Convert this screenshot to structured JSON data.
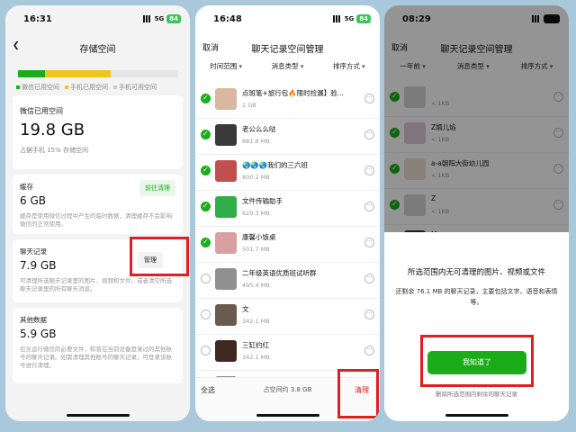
{
  "phone1": {
    "status": {
      "time": "16:31",
      "network": "5G",
      "battery": "84"
    },
    "title": "存储空间",
    "usage": {
      "wechat_pct": 17,
      "phone_pct": 41,
      "colors": {
        "wechat": "#1aad19",
        "phone": "#f0c419",
        "free": "#e6e6e6"
      },
      "legend": [
        "微信已用空间",
        "手机已用空间",
        "手机可用空间"
      ]
    },
    "summary": {
      "label": "微信已用空间",
      "value": "19.8 GB",
      "sub": "占据手机 15% 存储空间"
    },
    "cache": {
      "label": "缓存",
      "value": "6 GB",
      "desc": "缓存是使用微信过程中产生的临时数据，清理缓存不会影响微信的正常使用。",
      "button": "前往清理"
    },
    "chat": {
      "label": "聊天记录",
      "value": "7.9 GB",
      "desc": "可清理所选聊天记录里的图片、视频和文件，或者清空所选聊天记录里的所有聊天消息。",
      "button": "管理"
    },
    "other": {
      "label": "其他数据",
      "value": "5.9 GB",
      "desc": "包含运行微信的必要文件，和曾在当前设备登录过的其他账号的聊天记录。如需清理其他账号的聊天记录，可登录该账号进行清理。"
    }
  },
  "phone2": {
    "status": {
      "time": "16:48",
      "network": "5G",
      "battery": "84"
    },
    "cancel": "取消",
    "title": "聊天记录空间管理",
    "filters": [
      "时间范围",
      "消息类型",
      "排序方式"
    ],
    "chats": [
      {
        "name": "点斑笔+旅行包🔥限时捡漏】验...",
        "size": "1 GB",
        "checked": true,
        "avatar": "#d8b8a0"
      },
      {
        "name": "老公么么哒",
        "size": "881.8 MB",
        "checked": true,
        "avatar": "#3a3a3a"
      },
      {
        "name": "🌏🌏🌏我们的三六班",
        "size": "800.2 MB",
        "checked": true,
        "avatar": "#c05050"
      },
      {
        "name": "文件传输助手",
        "size": "629.3 MB",
        "checked": true,
        "avatar": "#2fae4a"
      },
      {
        "name": "康馨小饭桌",
        "size": "501.7 MB",
        "checked": true,
        "avatar": "#d8a0a0"
      },
      {
        "name": "二年级英语优质班试听群",
        "size": "495.4 MB",
        "checked": false,
        "avatar": "#909090"
      },
      {
        "name": "文",
        "size": "342.1 MB",
        "checked": false,
        "avatar": "#6a5a50"
      },
      {
        "name": "三缸约红",
        "size": "342.1 MB",
        "checked": false,
        "avatar": "#402820"
      },
      {
        "name": "三（6）班家长交流群",
        "size": "",
        "checked": false,
        "avatar": "#8a8a8a"
      }
    ],
    "bottom": {
      "select_all": "全选",
      "occupy": "占空间约 3.8 GB",
      "clean": "清理"
    }
  },
  "phone3": {
    "status": {
      "time": "08:29"
    },
    "cancel": "取消",
    "title": "聊天记录空间管理",
    "filters": [
      "一年前",
      "消息类型",
      "排序方式"
    ],
    "chats": [
      {
        "name": "",
        "size": "< 1KB",
        "avatar": "#d5d5d5"
      },
      {
        "name": "Z婿儿焰",
        "size": "< 1KB",
        "avatar": "#e0c8d8"
      },
      {
        "name": "a-a朝阳大街幼儿园",
        "size": "< 1KB",
        "avatar": "#e8e0d0"
      },
      {
        "name": "Z",
        "size": "< 1KB",
        "avatar": "#d5d5d5"
      },
      {
        "name": "Mary",
        "size": "< 1KB",
        "avatar": "#3a3030"
      }
    ],
    "dialog": {
      "title": "所选范围内无可清理的图片、视频或文件",
      "body": "还剩余 76.1 MB 的聊天记录，主要包括文字、语音和表情等。",
      "button": "我知道了",
      "link": "删除所选范围内剩余的聊天记录"
    }
  }
}
